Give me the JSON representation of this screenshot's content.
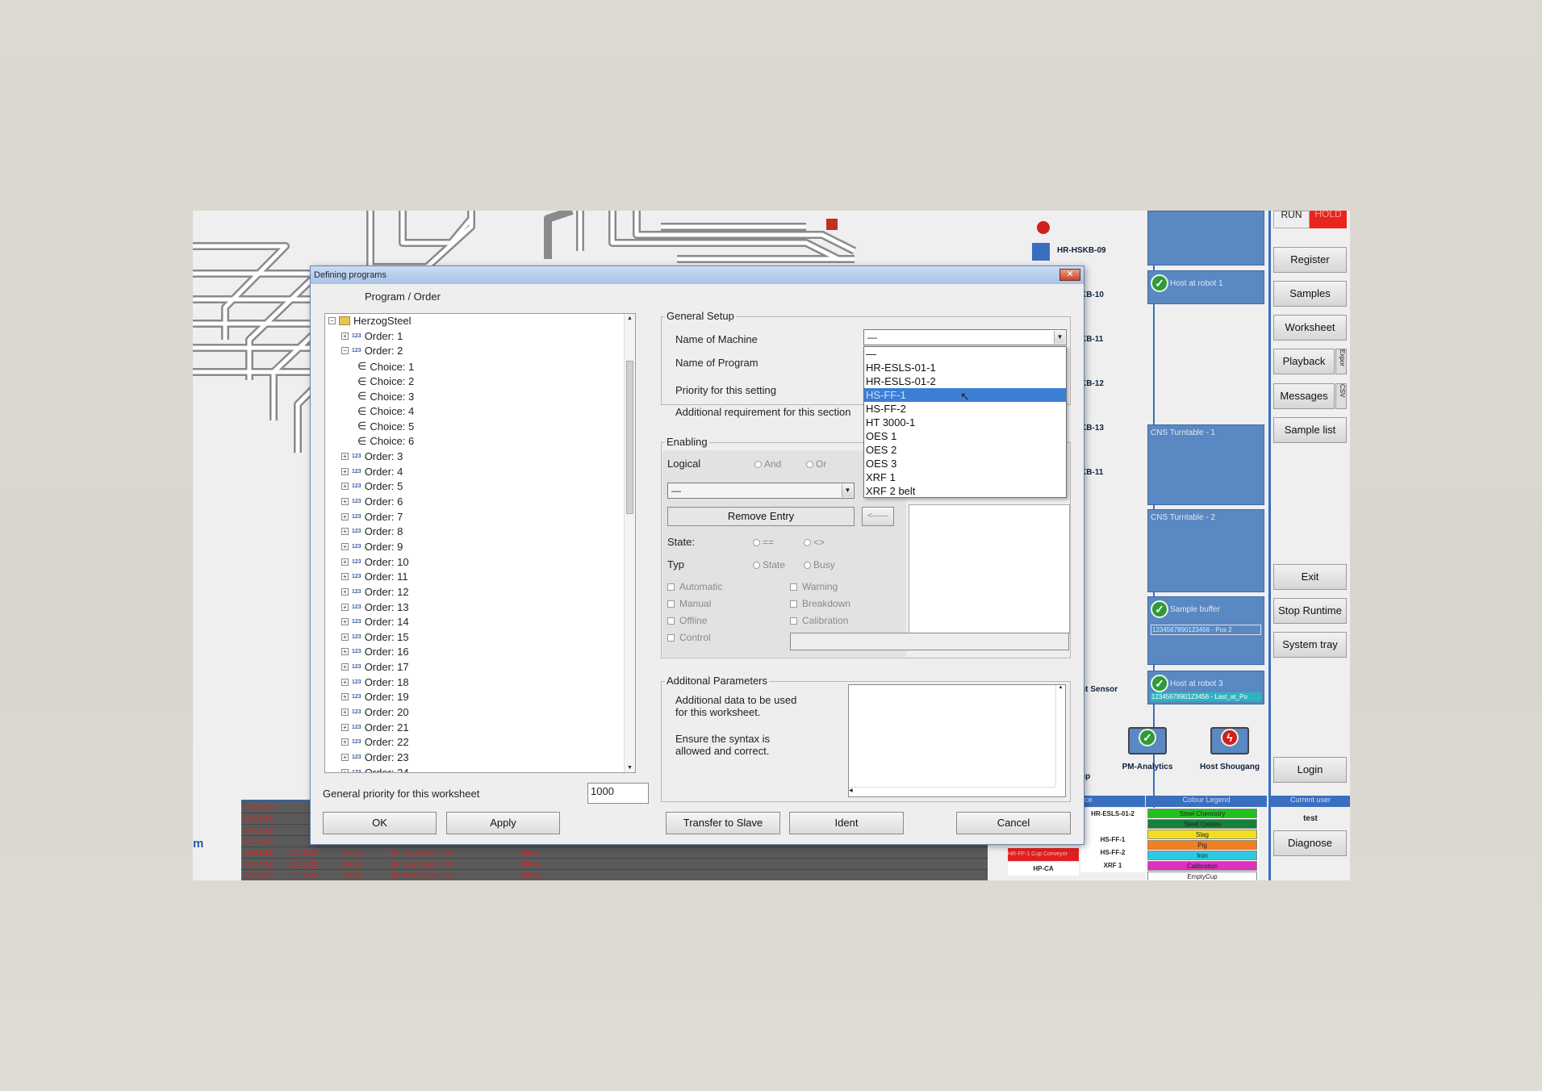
{
  "background_app": {
    "node_labels": [
      "HR-HSKB-09",
      "KB-10",
      "KB-11",
      "KB-12",
      "KB-13",
      "KB-11"
    ],
    "tiles": [
      {
        "label": "Host at robot 1"
      },
      {
        "label": "CNS Turntable - 1"
      },
      {
        "label": "CNS Turntable - 2"
      },
      {
        "label": "Sample buffer",
        "sub": "1234567890123456 - Pos 2"
      },
      {
        "label": "Host at robot 3",
        "sub": "1234567890123456 - Last_at_Po"
      }
    ],
    "run_label": "RUN",
    "hold_label": "HOLD",
    "buttons": [
      "Register",
      "Samples",
      "Worksheet",
      "Playback",
      "Messages",
      "Sample list",
      "Exit",
      "Stop Runtime",
      "System tray",
      "Login",
      "Diagnose"
    ],
    "side_tabs": [
      "Expor",
      "CSV"
    ],
    "devices": [
      "PM-Analytics",
      "Host Shougang"
    ],
    "partial_labels": [
      "ht Sensor",
      "up",
      "m",
      "oce"
    ],
    "colour_legend_title": "Colour Legend",
    "current_user_title": "Current user",
    "current_user": "test",
    "legend_items": [
      "Steel Chemistry",
      "Steel Oxides",
      "Slag",
      "Pig",
      "Iron",
      "Calibration",
      "EmptyCup"
    ],
    "machines_table": [
      "HR-ESLS-01-2",
      "HS-FF-1",
      "HS-FF-2",
      "XRF 1"
    ],
    "machines_table_left": [
      "HR-FF-1 Cup Conveyor",
      "HP-CA"
    ],
    "alarm_rows": [
      {
        "date": "03/04/18",
        "time": "11:15:22",
        "type": "Alarm",
        "source": "Terminal Station 03",
        "state": "Offline"
      },
      {
        "date": "03/04/18",
        "time": "11:15:22",
        "type": "Alarm",
        "source": "Terminal Station 03",
        "state": "Offline"
      },
      {
        "date": "03/04/18",
        "time": "11:15:22",
        "type": "Alarm",
        "source": "Terminal Station 03",
        "state": "Offline"
      }
    ],
    "alarm_dates_partial": [
      "03/04/18",
      "03/04/18",
      "03/04/18",
      "03/04/18",
      "03/04/18"
    ]
  },
  "dialog": {
    "title": "Defining programs",
    "close_glyph": "✕",
    "tree_header": "Program / Order",
    "root": "HerzogSteel",
    "order1": "Order: 1",
    "order2": "Order: 2",
    "choices": [
      "Choice: 1",
      "Choice: 2",
      "Choice: 3",
      "Choice: 4",
      "Choice: 5",
      "Choice: 6"
    ],
    "orders_rest": [
      "Order: 3",
      "Order: 4",
      "Order: 5",
      "Order: 6",
      "Order: 7",
      "Order: 8",
      "Order: 9",
      "Order: 10",
      "Order: 11",
      "Order: 12",
      "Order: 13",
      "Order: 14",
      "Order: 15",
      "Order: 16",
      "Order: 17",
      "Order: 18",
      "Order: 19",
      "Order: 20",
      "Order: 21",
      "Order: 22",
      "Order: 23",
      "Order: 24"
    ],
    "general_priority_label": "General priority for this worksheet",
    "general_priority_value": "1000",
    "buttons": {
      "ok": "OK",
      "apply": "Apply",
      "transfer": "Transfer to Slave",
      "ident": "Ident",
      "cancel": "Cancel"
    },
    "general_setup": {
      "title": "General Setup",
      "machine_label": "Name of Machine",
      "program_label": "Name of Program",
      "priority_label": "Priority for this setting",
      "additional_label": "Additional requirement for this section",
      "machine_value": "—",
      "dropdown_items": [
        "—",
        "HR-ESLS-01-1",
        "HR-ESLS-01-2",
        "HS-FF-1",
        "HS-FF-2",
        "HT 3000-1",
        "OES 1",
        "OES 2",
        "OES 3",
        "XRF 1",
        "XRF 2 belt"
      ],
      "selected_index": 3
    },
    "enabling": {
      "title": "Enabling",
      "logical_label": "Logical",
      "and_label": "And",
      "or_label": "Or",
      "combo_value": "—",
      "remove_label": "Remove Entry",
      "arrow_label": "<——",
      "state_label": "State:",
      "eq_label": "==",
      "neq_label": "<>",
      "typ_label": "Typ",
      "state_opt": "State",
      "busy_opt": "Busy",
      "checks_left": [
        "Automatic",
        "Manual",
        "Offline",
        "Control"
      ],
      "checks_right": [
        "Warning",
        "Breakdown",
        "Calibration"
      ]
    },
    "additional": {
      "title": "Additonal Parameters",
      "desc1": "Additional data to be used",
      "desc2": "for this worksheet.",
      "desc3": "Ensure the syntax is",
      "desc4": "allowed and correct."
    }
  },
  "colors": {
    "accent": "#5a88c2",
    "selection": "#3b7fd6",
    "alarm_text": "#e02020",
    "hold": "#e8261e"
  }
}
